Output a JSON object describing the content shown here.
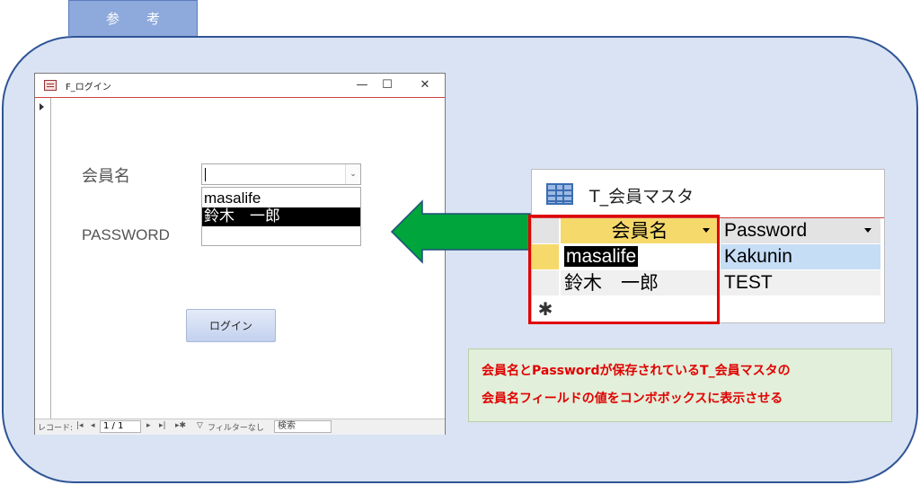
{
  "tab_label": "参考",
  "form": {
    "title": "F_ログイン",
    "minimize": "—",
    "maximize": "☐",
    "close": "✕",
    "member_label": "会員名",
    "password_label": "PASSWORD",
    "combo_value": "",
    "combo_arrow": "⌄",
    "dropdown_items": [
      "masalife",
      "鈴木　一郎"
    ],
    "login_label": "ログイン",
    "nav": {
      "record_label": "レコード:",
      "first": "|◂",
      "prev": "◂",
      "position": "1 / 1",
      "next": "▸",
      "last": "▸|",
      "new": "▸✱",
      "filter": "フィルターなし",
      "search": "検索"
    }
  },
  "table": {
    "title": "T_会員マスタ",
    "columns": [
      "会員名",
      "Password"
    ],
    "rows": [
      [
        "masalife",
        "Kakunin"
      ],
      [
        "鈴木　一郎",
        "TEST"
      ]
    ],
    "new_row_marker": "✱"
  },
  "note": {
    "line1": "会員名とPasswordが保存されているT_会員マスタの",
    "line2": "会員名フィールドの値をコンボボックスに表示させる"
  },
  "colors": {
    "panel_bg": "#dae3f3",
    "panel_border": "#2f5597",
    "arrow_fill": "#00a53c",
    "arrow_border": "#1f4e79",
    "highlight_border": "#e00000",
    "note_text": "#e00000"
  }
}
